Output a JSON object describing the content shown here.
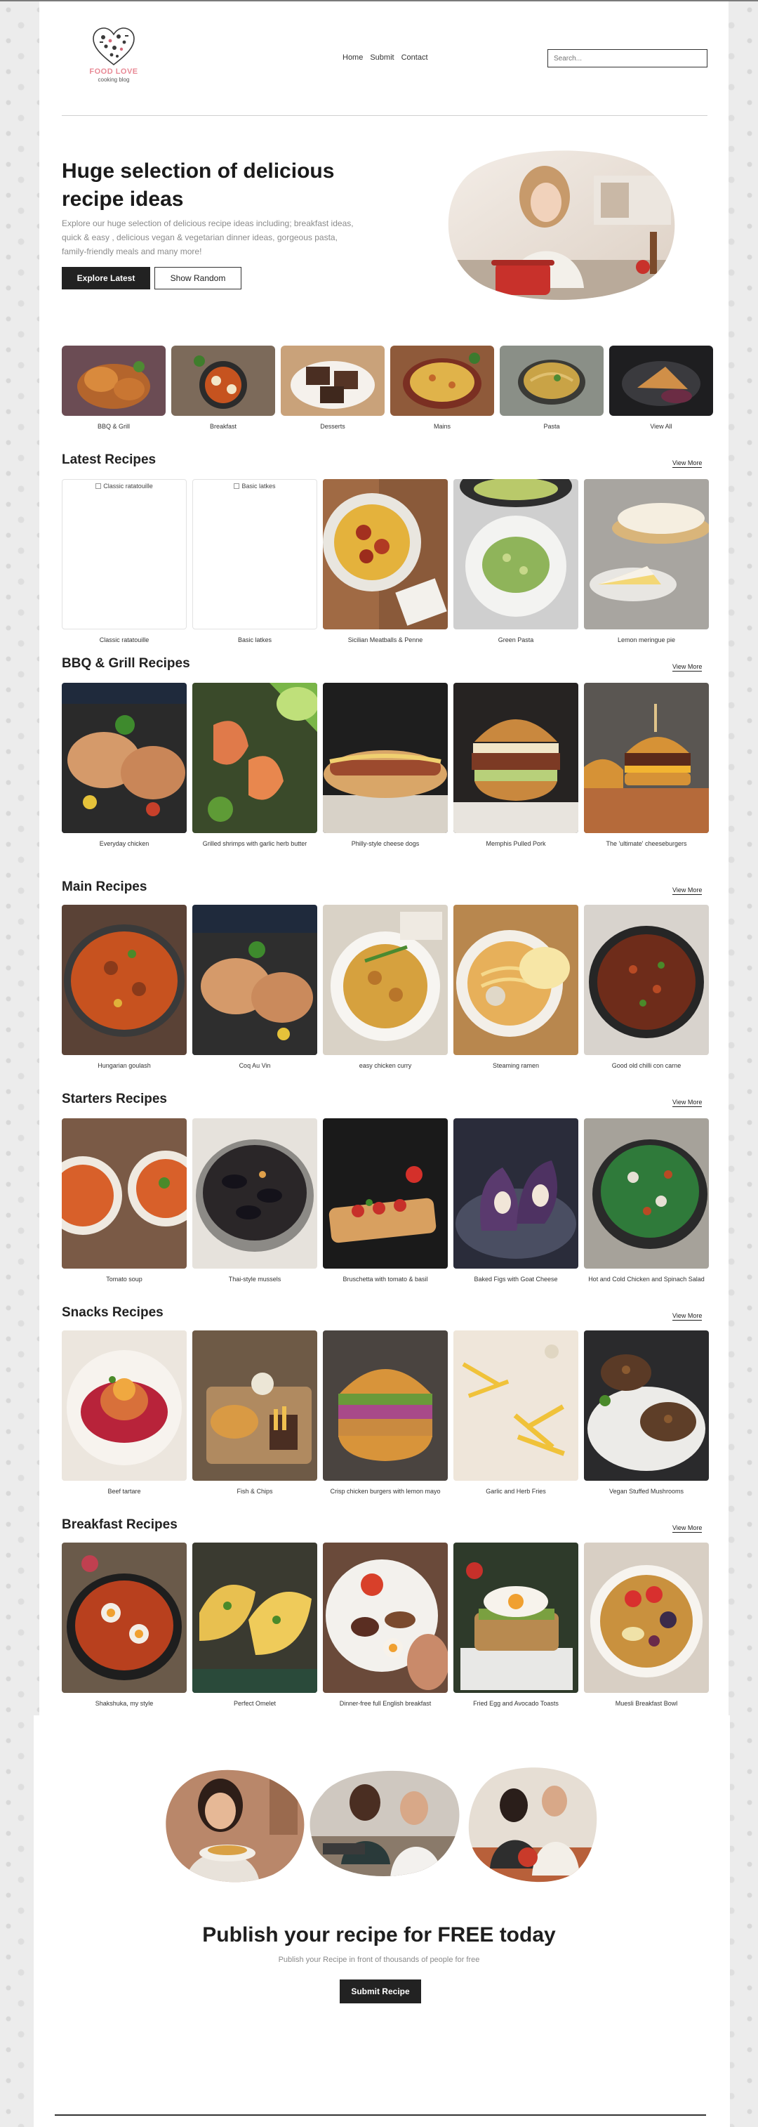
{
  "header": {
    "brand": "FOOD LOVE",
    "tagline": "cooking blog",
    "nav": [
      "Home",
      "Submit",
      "Contact"
    ],
    "search_placeholder": "Search..."
  },
  "hero": {
    "title": "Huge selection of delicious recipe ideas",
    "description": "Explore our huge selection of delicious recipe ideas including; breakfast ideas, quick & easy , delicious vegan & vegetarian dinner ideas, gorgeous pasta, family-friendly meals and many more!",
    "primary_button": "Explore Latest",
    "secondary_button": "Show Random"
  },
  "categories": [
    {
      "label": "BBQ & Grill",
      "icon": "bbq-food-photo"
    },
    {
      "label": "Breakfast",
      "icon": "breakfast-food-photo"
    },
    {
      "label": "Desserts",
      "icon": "dessert-food-photo"
    },
    {
      "label": "Mains",
      "icon": "mains-food-photo"
    },
    {
      "label": "Pasta",
      "icon": "pasta-food-photo"
    },
    {
      "label": "View All",
      "icon": "view-all-food-photo"
    }
  ],
  "view_more_label": "View More",
  "sections": [
    {
      "title": "Latest Recipes",
      "items": [
        {
          "name": "Classic ratatouille",
          "broken": true
        },
        {
          "name": "Basic latkes",
          "broken": true
        },
        {
          "name": "Sicilian Meatballs & Penne"
        },
        {
          "name": "Green Pasta"
        },
        {
          "name": "Lemon meringue pie"
        }
      ]
    },
    {
      "title": "BBQ & Grill Recipes",
      "items": [
        {
          "name": "Everyday chicken"
        },
        {
          "name": "Grilled shrimps with garlic herb butter"
        },
        {
          "name": "Philly-style cheese dogs"
        },
        {
          "name": "Memphis Pulled Pork"
        },
        {
          "name": "The 'ultimate' cheeseburgers"
        }
      ]
    },
    {
      "title": "Main Recipes",
      "items": [
        {
          "name": "Hungarian goulash"
        },
        {
          "name": "Coq Au Vin"
        },
        {
          "name": "easy chicken curry"
        },
        {
          "name": "Steaming ramen"
        },
        {
          "name": "Good old chilli con carne"
        }
      ]
    },
    {
      "title": "Starters Recipes",
      "items": [
        {
          "name": "Tomato soup"
        },
        {
          "name": "Thai-style mussels"
        },
        {
          "name": "Bruschetta with tomato & basil"
        },
        {
          "name": "Baked Figs with Goat Cheese"
        },
        {
          "name": "Hot and Cold Chicken and Spinach Salad"
        }
      ]
    },
    {
      "title": "Snacks Recipes",
      "items": [
        {
          "name": "Beef tartare"
        },
        {
          "name": "Fish & Chips"
        },
        {
          "name": "Crisp chicken burgers with lemon mayo"
        },
        {
          "name": "Garlic and Herb Fries"
        },
        {
          "name": "Vegan Stuffed Mushrooms"
        }
      ]
    },
    {
      "title": "Breakfast Recipes",
      "items": [
        {
          "name": "Shakshuka, my style"
        },
        {
          "name": "Perfect Omelet"
        },
        {
          "name": "Dinner-free full English breakfast"
        },
        {
          "name": "Fried Egg and Avocado Toasts"
        },
        {
          "name": "Muesli Breakfast Bowl"
        }
      ]
    }
  ],
  "publish": {
    "title": "Publish your recipe for FREE today",
    "description": "Publish your Recipe in front of thousands of people for free",
    "button": "Submit Recipe"
  },
  "colors": {
    "accent_dark": "#222222",
    "brand_pink": "#e88a96",
    "muted_text": "#8b8b8b",
    "backdrop": "#ececec"
  }
}
